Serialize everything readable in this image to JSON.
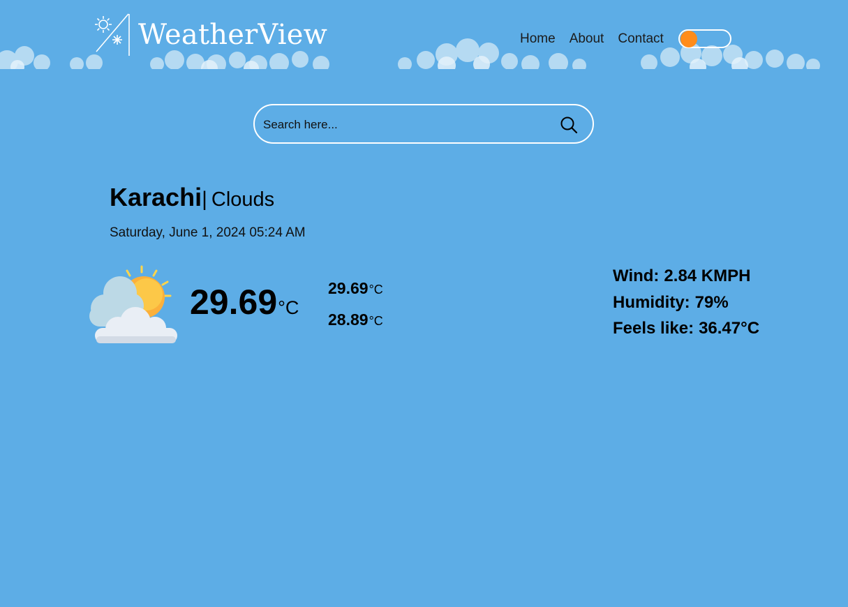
{
  "header": {
    "logo_text": "WeatherView",
    "nav": [
      "Home",
      "About",
      "Contact"
    ],
    "theme_toggle": "on"
  },
  "search": {
    "placeholder": "Search here..."
  },
  "weather": {
    "city": "Karachi",
    "separator": "|",
    "condition": "Clouds",
    "datetime": "Saturday, June 1, 2024 05:24 AM",
    "icon": "sun-behind-clouds-icon",
    "temp": "29.69",
    "temp_unit": "°C",
    "temp_max": "29.69",
    "temp_min": "28.89",
    "wind_label": "Wind:",
    "wind_value": "2.84 KMPH",
    "humidity_label": "Humidity:",
    "humidity_value": "79%",
    "feels_label": "Feels like:",
    "feels_value": "36.47°C"
  },
  "colors": {
    "background": "#5dade6",
    "cloud": "#d5ebf8",
    "accent": "#ff8c1a",
    "text": "#000000",
    "logo": "#ffffff"
  }
}
